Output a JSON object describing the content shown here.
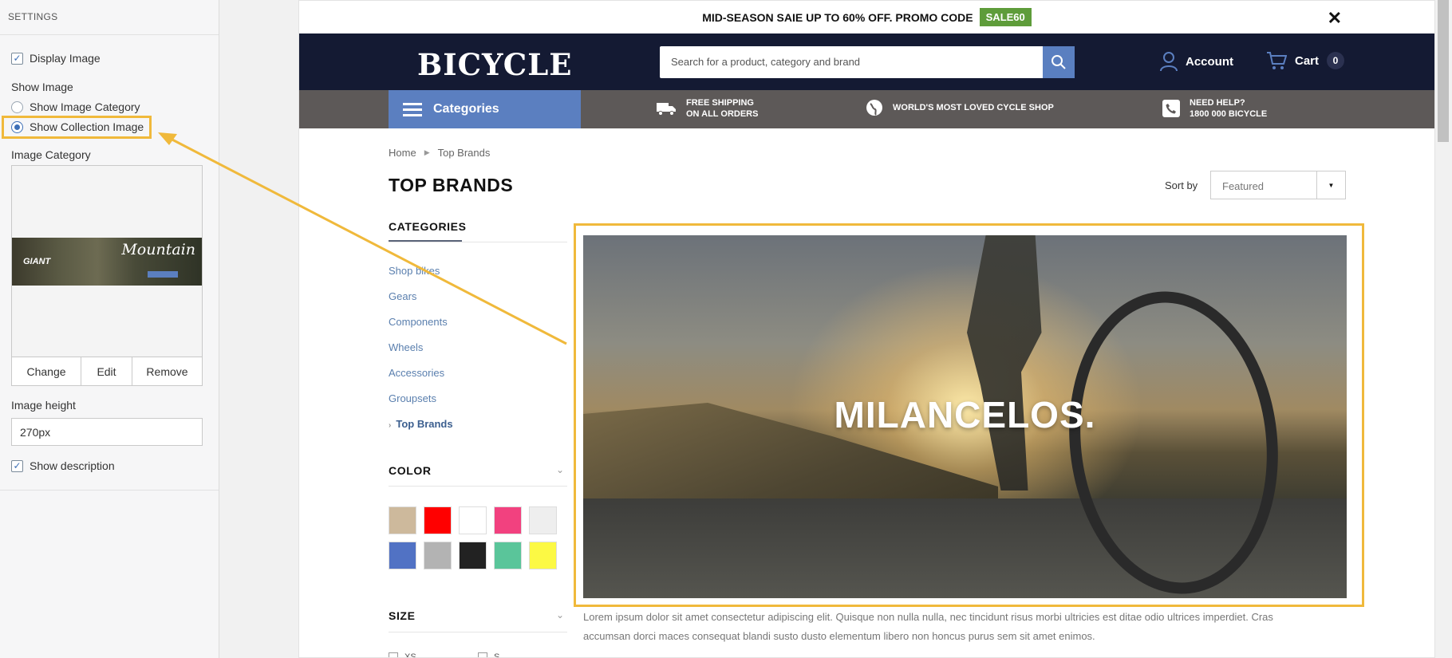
{
  "settings": {
    "header": "SETTINGS",
    "display_image": "Display Image",
    "show_image_label": "Show Image",
    "show_image_category": "Show Image Category",
    "show_collection_image": "Show Collection Image",
    "image_category_label": "Image Category",
    "thumb_brand": "GIANT",
    "thumb_text": "Mountain",
    "btn_change": "Change",
    "btn_edit": "Edit",
    "btn_remove": "Remove",
    "image_height_label": "Image height",
    "image_height_value": "270px",
    "show_description": "Show description"
  },
  "store": {
    "promo_text": "MID-SEASON SAIE UP TO 60% OFF. PROMO CODE",
    "promo_code": "SALE60",
    "logo": "BICYCLE",
    "search_placeholder": "Search for a product, category and brand",
    "account": "Account",
    "cart": "Cart",
    "cart_count": "0",
    "categories_btn": "Categories",
    "feature1_line1": "FREE SHIPPING",
    "feature1_line2": "ON ALL ORDERS",
    "feature2": "WORLD'S MOST LOVED CYCLE SHOP",
    "feature3_line1": "NEED HELP?",
    "feature3_line2": "1800 000 BICYCLE",
    "breadcrumb_home": "Home",
    "breadcrumb_current": "Top Brands",
    "page_title": "TOP BRANDS",
    "sort_label": "Sort by",
    "sort_value": "Featured",
    "categories_title": "CATEGORIES",
    "categories": [
      "Shop bikes",
      "Gears",
      "Components",
      "Wheels",
      "Accessories",
      "Groupsets",
      "Top Brands"
    ],
    "color_title": "COLOR",
    "colors": [
      "#cdb99c",
      "#ff0000",
      "#ffffff",
      "#f2417f",
      "#eeeeee",
      "#5172c4",
      "#b3b3b3",
      "#222222",
      "#5ac59a",
      "#fcf944"
    ],
    "size_title": "SIZE",
    "sizes": [
      "XS",
      "S"
    ],
    "hero_title": "MILANCELOS.",
    "description": "Lorem ipsum dolor sit amet consectetur adipiscing elit. Quisque non nulla nulla, nec tincidunt risus morbi ultricies est ditae odio ultrices imperdiet. Cras accumsan dorci maces consequat blandi susto dusto elementum libero non honcus purus sem sit amet enimos."
  },
  "colors": {
    "highlight": "#f0b93b",
    "header_bg": "#141a33",
    "accent": "#5b7fc0",
    "promo_code_bg": "#5e9c3a"
  }
}
